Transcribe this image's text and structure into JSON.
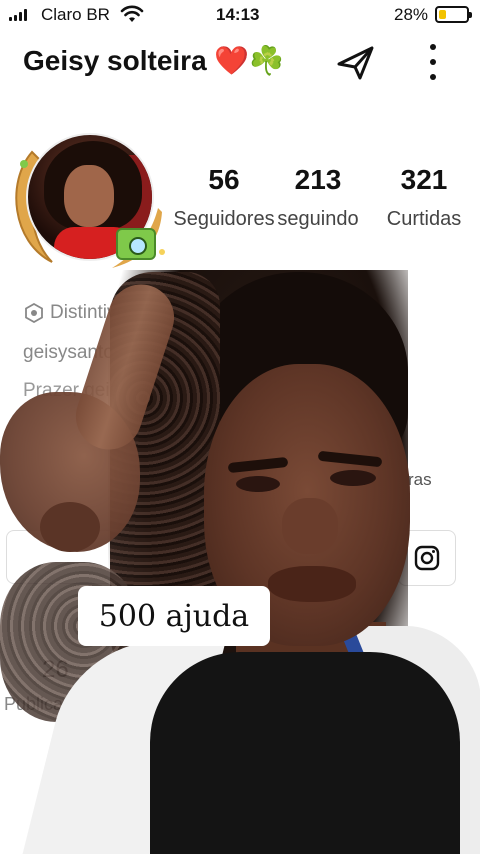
{
  "status_bar": {
    "carrier": "Claro BR",
    "time": "14:13",
    "battery_percent": "28%",
    "battery_level": 0.28,
    "battery_color": "#f2c200"
  },
  "header": {
    "profile_name": "Geisy solteira ❤️☘️",
    "share_icon": "share-arrow-icon",
    "more_icon": "vertical-ellipsis-icon"
  },
  "stats": {
    "followers": {
      "value": "56",
      "label": "Seguidores"
    },
    "following": {
      "value": "213",
      "label": "seguindo"
    },
    "likes": {
      "value": "321",
      "label": "Curtidas"
    }
  },
  "bio": {
    "badge_label": "Distintivo",
    "username_fragment": "geisysantos8",
    "line1_fragment": "Prazer geis",
    "line2_fragment": "",
    "fragment_right": "ras"
  },
  "posts": {
    "count": "26",
    "label_fragment": "Publicaç"
  },
  "overlay": {
    "caption": "500 ajuda"
  },
  "colors": {
    "accent_gold": "#e0a64a",
    "shirt_stripe": "#2a4a9a"
  }
}
